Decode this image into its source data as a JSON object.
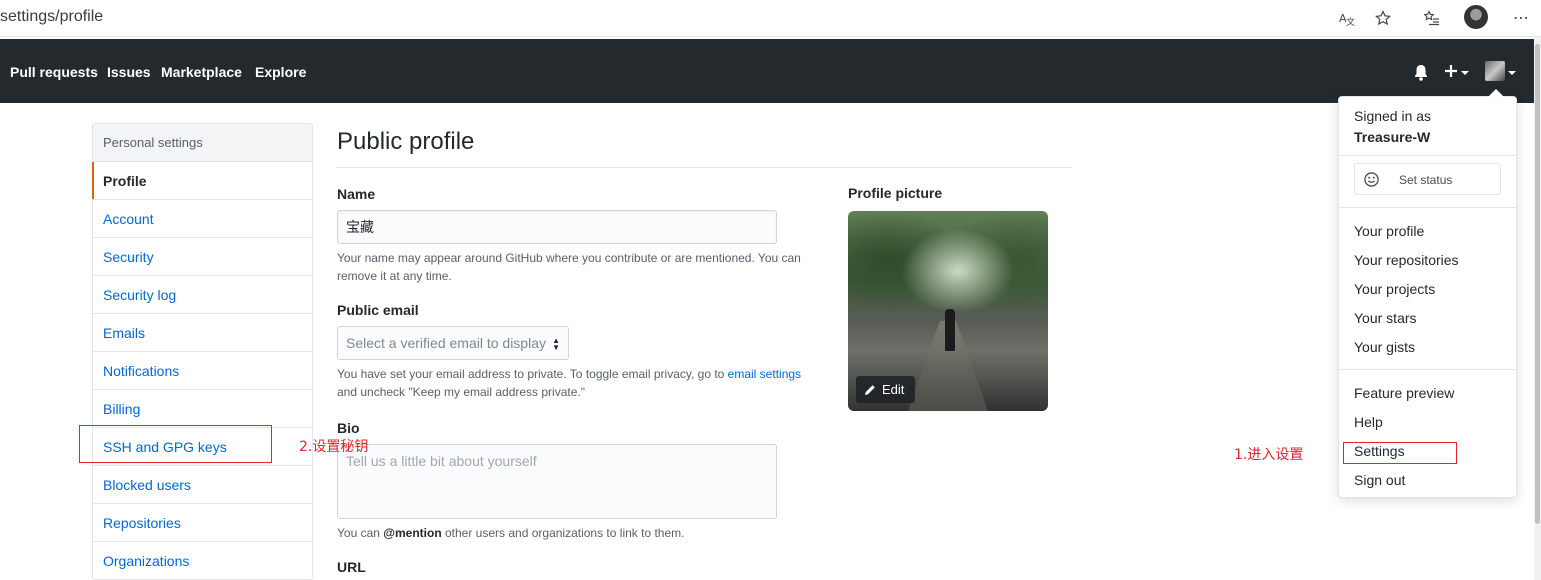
{
  "browser": {
    "url": "settings/profile",
    "icons": [
      "translate-icon",
      "favorite-star-icon",
      "favorites-list-icon",
      "user-avatar",
      "more-icon"
    ]
  },
  "header": {
    "nav": [
      "Pull requests",
      "Issues",
      "Marketplace",
      "Explore"
    ],
    "icons": [
      "bell-icon",
      "plus-icon",
      "avatar"
    ]
  },
  "sidebar": {
    "heading": "Personal settings",
    "items": [
      {
        "label": "Profile",
        "selected": true
      },
      {
        "label": "Account"
      },
      {
        "label": "Security"
      },
      {
        "label": "Security log"
      },
      {
        "label": "Emails"
      },
      {
        "label": "Notifications"
      },
      {
        "label": "Billing"
      },
      {
        "label": "SSH and GPG keys"
      },
      {
        "label": "Blocked users"
      },
      {
        "label": "Repositories"
      },
      {
        "label": "Organizations"
      }
    ]
  },
  "main": {
    "title": "Public profile",
    "name_label": "Name",
    "name_value": "宝藏",
    "name_note": "Your name may appear around GitHub where you contribute or are mentioned. You can remove it at any time.",
    "email_label": "Public email",
    "email_select": "Select a verified email to display",
    "email_note_before": "You have set your email address to private. To toggle email privacy, go to",
    "email_note_link": "email settings",
    "email_note_after": "and uncheck \"Keep my email address private.\"",
    "bio_label": "Bio",
    "bio_placeholder": "Tell us a little bit about yourself",
    "bio_note_before": "You can",
    "bio_note_mention": "@mention",
    "bio_note_after": "other users and organizations to link to them.",
    "url_label": "URL",
    "picture_label": "Profile picture",
    "edit_label": "Edit"
  },
  "dropdown": {
    "signed_in_as": "Signed in as",
    "username": "Treasure-W",
    "set_status": "Set status",
    "group1": [
      "Your profile",
      "Your repositories",
      "Your projects",
      "Your stars",
      "Your gists"
    ],
    "group2": [
      "Feature preview",
      "Help",
      "Settings",
      "Sign out"
    ]
  },
  "annotations": {
    "step1": "1.进入设置",
    "step2": "2.设置秘钥",
    "color": "#e3242b"
  }
}
